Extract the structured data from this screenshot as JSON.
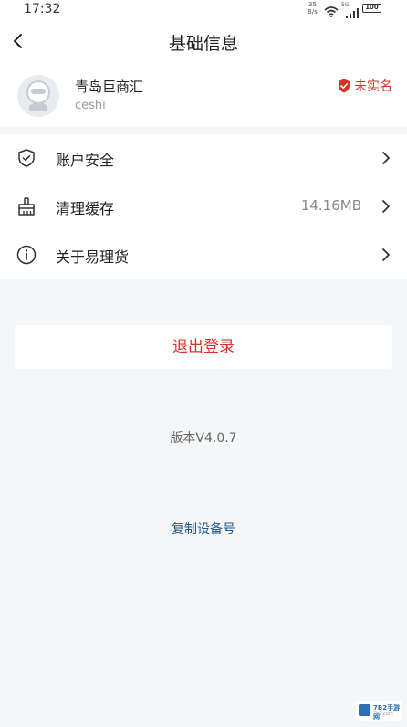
{
  "status_bar": {
    "time": "17:32",
    "net_speed_value": "35",
    "net_speed_unit": "B/s",
    "signal_label": "5G",
    "battery": "100"
  },
  "nav": {
    "back_icon": "chevron-left-icon",
    "title": "基础信息"
  },
  "profile": {
    "company_name": "青岛巨商汇",
    "username": "ceshi",
    "verify_status": "未实名",
    "verify_icon": "shield-check-icon",
    "accent_color": "#d8312a"
  },
  "menu": {
    "items": [
      {
        "label": "账户安全",
        "icon": "shield-icon",
        "value": ""
      },
      {
        "label": "清理缓存",
        "icon": "broom-icon",
        "value": "14.16MB"
      },
      {
        "label": "关于易理货",
        "icon": "info-icon",
        "value": ""
      }
    ]
  },
  "logout": {
    "label": "退出登录"
  },
  "version": {
    "text": "版本V4.0.7"
  },
  "copy_device": {
    "label": "复制设备号"
  },
  "watermark": {
    "text": "7B2手游网",
    "sub": "7b2.com"
  }
}
